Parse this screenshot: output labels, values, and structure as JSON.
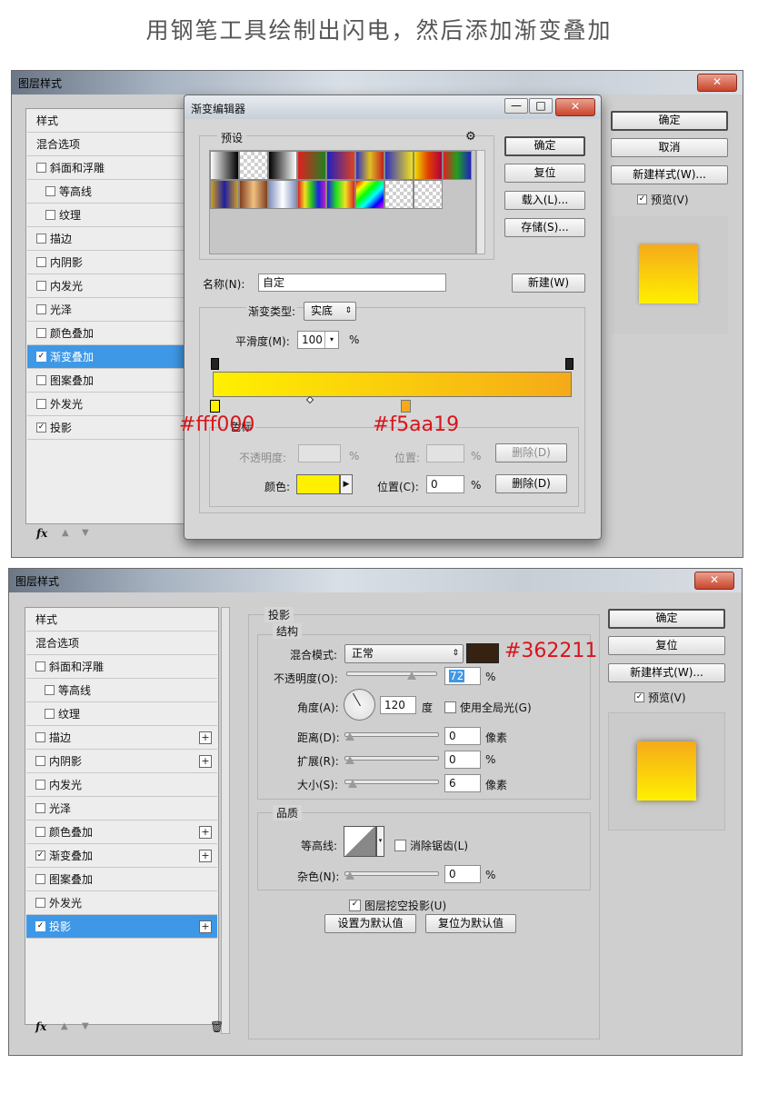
{
  "page_title": "用钢笔工具绘制出闪电，然后添加渐变叠加",
  "dialog1": {
    "title": "图层样式",
    "close": "✕",
    "buttons": {
      "ok": "确定",
      "cancel": "取消",
      "new_style": "新建样式(W)...",
      "preview": "预览(V)"
    },
    "preview_checked": "✓",
    "list": [
      {
        "label": "样式",
        "checked": null,
        "indent": false,
        "selected": false
      },
      {
        "label": "混合选项",
        "checked": null,
        "indent": false,
        "selected": false
      },
      {
        "label": "斜面和浮雕",
        "checked": false,
        "indent": false,
        "selected": false
      },
      {
        "label": "等高线",
        "checked": false,
        "indent": true,
        "selected": false
      },
      {
        "label": "纹理",
        "checked": false,
        "indent": true,
        "selected": false
      },
      {
        "label": "描边",
        "checked": false,
        "indent": false,
        "selected": false
      },
      {
        "label": "内阴影",
        "checked": false,
        "indent": false,
        "selected": false
      },
      {
        "label": "内发光",
        "checked": false,
        "indent": false,
        "selected": false
      },
      {
        "label": "光泽",
        "checked": false,
        "indent": false,
        "selected": false
      },
      {
        "label": "颜色叠加",
        "checked": false,
        "indent": false,
        "selected": false
      },
      {
        "label": "渐变叠加",
        "checked": true,
        "indent": false,
        "selected": true
      },
      {
        "label": "图案叠加",
        "checked": false,
        "indent": false,
        "selected": false
      },
      {
        "label": "外发光",
        "checked": false,
        "indent": false,
        "selected": false
      },
      {
        "label": "投影",
        "checked": true,
        "indent": false,
        "selected": false
      }
    ],
    "fx": "fx",
    "up_icon": "▲",
    "down_icon": "▼"
  },
  "gradient_editor": {
    "title": "渐变编辑器",
    "presets_label": "预设",
    "gear": "⚙",
    "buttons": {
      "ok": "确定",
      "reset": "复位",
      "load": "载入(L)...",
      "save": "存储(S)...",
      "new": "新建(W)"
    },
    "name_label": "名称(N):",
    "name_value": "自定",
    "type_label": "渐变类型:",
    "type_value": "实底",
    "smooth_label": "平滑度(M):",
    "smooth_value": "100",
    "smooth_unit": "%",
    "stops_group_label": "色标",
    "opacity_label": "不透明度:",
    "opacity_unit": "%",
    "location_label_1": "位置:",
    "location_unit_1": "%",
    "delete_1": "删除(D)",
    "color_label": "颜色:",
    "location_label_2": "位置(C):",
    "location_value_2": "0",
    "location_unit_2": "%",
    "delete_2": "删除(D)",
    "colors": {
      "start": "#fff000",
      "end": "#f5aa19"
    },
    "annotation_start": "#fff000",
    "annotation_end": "#f5aa19"
  },
  "dialog2": {
    "title": "图层样式",
    "close": "✕",
    "buttons": {
      "ok": "确定",
      "reset": "复位",
      "new_style": "新建样式(W)...",
      "preview": "预览(V)"
    },
    "preview_checked": "✓",
    "list": [
      {
        "label": "样式",
        "checked": null,
        "indent": false,
        "selected": false,
        "plus": false
      },
      {
        "label": "混合选项",
        "checked": null,
        "indent": false,
        "selected": false,
        "plus": false
      },
      {
        "label": "斜面和浮雕",
        "checked": false,
        "indent": false,
        "selected": false,
        "plus": false
      },
      {
        "label": "等高线",
        "checked": false,
        "indent": true,
        "selected": false,
        "plus": false
      },
      {
        "label": "纹理",
        "checked": false,
        "indent": true,
        "selected": false,
        "plus": false
      },
      {
        "label": "描边",
        "checked": false,
        "indent": false,
        "selected": false,
        "plus": true
      },
      {
        "label": "内阴影",
        "checked": false,
        "indent": false,
        "selected": false,
        "plus": true
      },
      {
        "label": "内发光",
        "checked": false,
        "indent": false,
        "selected": false,
        "plus": false
      },
      {
        "label": "光泽",
        "checked": false,
        "indent": false,
        "selected": false,
        "plus": false
      },
      {
        "label": "颜色叠加",
        "checked": false,
        "indent": false,
        "selected": false,
        "plus": true
      },
      {
        "label": "渐变叠加",
        "checked": true,
        "indent": false,
        "selected": false,
        "plus": true
      },
      {
        "label": "图案叠加",
        "checked": false,
        "indent": false,
        "selected": false,
        "plus": false
      },
      {
        "label": "外发光",
        "checked": false,
        "indent": false,
        "selected": false,
        "plus": false
      },
      {
        "label": "投影",
        "checked": true,
        "indent": false,
        "selected": true,
        "plus": true
      }
    ],
    "fx": "fx",
    "up_icon": "▲",
    "down_icon": "▼",
    "trash_icon": "🗑",
    "shadow": {
      "section_title": "投影",
      "structure_title": "结构",
      "blend_label": "混合模式:",
      "blend_value": "正常",
      "shadow_color": "#362211",
      "annotation_color": "#362211",
      "opacity_label": "不透明度(O):",
      "opacity_value": "72",
      "opacity_level": 0.72,
      "opacity_unit": "%",
      "angle_label": "角度(A):",
      "angle_value": "120",
      "angle_unit": "度",
      "global_light_label": "使用全局光(G)",
      "distance_label": "距离(D):",
      "distance_value": "0",
      "distance_unit": "像素",
      "spread_label": "扩展(R):",
      "spread_value": "0",
      "spread_unit": "%",
      "size_label": "大小(S):",
      "size_value": "6",
      "size_unit": "像素",
      "quality_title": "品质",
      "contour_label": "等高线:",
      "antialias_label": "消除锯齿(L)",
      "noise_label": "杂色(N):",
      "noise_value": "0",
      "noise_unit": "%",
      "knockout_label": "图层挖空投影(U)",
      "knockout_checked": "✓",
      "set_default": "设置为默认值",
      "reset_default": "复位为默认值"
    }
  }
}
